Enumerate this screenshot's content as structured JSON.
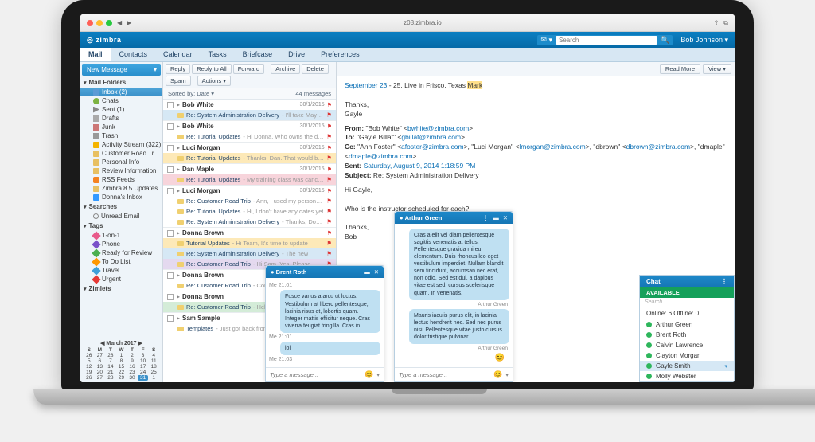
{
  "browser": {
    "url": "z08.zimbra.io"
  },
  "app": {
    "brand": "zimbra",
    "search_placeholder": "Search",
    "user": "Bob Johnson"
  },
  "tabs": [
    "Mail",
    "Contacts",
    "Calendar",
    "Tasks",
    "Briefcase",
    "Drive",
    "Preferences"
  ],
  "newmsg": "New Message",
  "sections": {
    "folders_hdr": "Mail Folders",
    "searches_hdr": "Searches",
    "tags_hdr": "Tags",
    "zimlets_hdr": "Zimlets"
  },
  "folders": [
    {
      "label": "Inbox (2)",
      "sel": true,
      "icon": "inbox"
    },
    {
      "label": "Chats",
      "icon": "chat"
    },
    {
      "label": "Sent (1)",
      "icon": "sent"
    },
    {
      "label": "Drafts",
      "icon": "draft"
    },
    {
      "label": "Junk",
      "icon": "junk"
    },
    {
      "label": "Trash",
      "icon": "trash"
    },
    {
      "label": "Activity Stream (322)",
      "icon": "act"
    },
    {
      "label": "Customer Road Tr",
      "icon": "folder"
    },
    {
      "label": "Personal Info",
      "icon": "folder"
    },
    {
      "label": "Review Information",
      "icon": "folder"
    },
    {
      "label": "RSS Feeds",
      "icon": "rss"
    },
    {
      "label": "Zimbra 8.5 Updates",
      "icon": "folder"
    },
    {
      "label": "Donna's Inbox",
      "icon": "share"
    }
  ],
  "searches": [
    {
      "label": "Unread Email"
    }
  ],
  "tags": [
    {
      "label": "1-on-1",
      "color": "#e85a8b"
    },
    {
      "label": "Phone",
      "color": "#7a52c9"
    },
    {
      "label": "Ready for Review",
      "color": "#4caf50"
    },
    {
      "label": "To Do List",
      "color": "#ff9800"
    },
    {
      "label": "Travel",
      "color": "#3f9fd8"
    },
    {
      "label": "Urgent",
      "color": "#e53935"
    }
  ],
  "calendar": {
    "title": "March 2017",
    "dow": [
      "S",
      "M",
      "T",
      "W",
      "T",
      "F",
      "S"
    ],
    "rows": [
      [
        "26",
        "27",
        "28",
        "1",
        "2",
        "3",
        "4"
      ],
      [
        "5",
        "6",
        "7",
        "8",
        "9",
        "10",
        "11"
      ],
      [
        "12",
        "13",
        "14",
        "15",
        "16",
        "17",
        "18"
      ],
      [
        "19",
        "20",
        "21",
        "22",
        "23",
        "24",
        "25"
      ],
      [
        "26",
        "27",
        "28",
        "29",
        "30",
        "31",
        "1"
      ]
    ],
    "today": "31"
  },
  "toolbar": [
    "Reply",
    "Reply to All",
    "Forward",
    "Archive",
    "Delete",
    "Spam",
    "Actions ▾"
  ],
  "sort": {
    "label": "Sorted by: Date ▾",
    "count": "44 messages"
  },
  "readbar": {
    "readmore": "Read More",
    "view": "View ▾"
  },
  "threads": [
    {
      "from": "Bob White",
      "date": "30/1/2015",
      "lines": [
        {
          "cls": "t-blue",
          "sub": "Re: System Administration Delivery",
          "prev": "- I'll take May and October. Bob F..."
        }
      ]
    },
    {
      "from": "Bob White",
      "date": "30/1/2015",
      "lines": [
        {
          "cls": "",
          "sub": "Re: Tutorial Updates",
          "prev": "- Hi Donna, Who owns the demo content updates? T"
        }
      ]
    },
    {
      "from": "Luci Morgan",
      "date": "30/1/2015",
      "lines": [
        {
          "cls": "t-yellow",
          "sub": "Re: Tutorial Updates",
          "prev": "- Thanks, Dan. That would be a huge help for m"
        }
      ]
    },
    {
      "from": "Dan Maple",
      "date": "30/1/2015",
      "lines": [
        {
          "cls": "t-pink",
          "sub": "Re: Tutorial Updates",
          "prev": "- My training class was cancelled next month, so"
        }
      ]
    },
    {
      "from": "Luci Morgan",
      "date": "30/1/2015",
      "lines": [
        {
          "cls": "",
          "sub": "Re: Customer Road Trip",
          "prev": "- Ann, I used my personal CC. L. From: \"afost"
        },
        {
          "cls": "",
          "sub": "Re: Tutorial Updates",
          "prev": "- Hi, I don't have any dates yet"
        },
        {
          "cls": "",
          "sub": "Re: System Administration Delivery",
          "prev": "- Thanks, Donna. I'm glad"
        }
      ]
    },
    {
      "from": "Donna Brown",
      "date": "",
      "lines": [
        {
          "cls": "t-yellow",
          "sub": "Tutorial Updates",
          "prev": "- Hi Team, It's time to update"
        },
        {
          "cls": "t-blue",
          "sub": "Re: System Administration Delivery",
          "prev": "- The new"
        },
        {
          "cls": "t-purple",
          "sub": "Re: Customer Road Trip",
          "prev": "- Hi Sam, Yes. Please"
        }
      ]
    },
    {
      "from": "Donna Brown",
      "date": "",
      "lines": [
        {
          "cls": "",
          "sub": "Re: Customer Road Trip",
          "prev": "- Corp travel? From: \"D"
        }
      ]
    },
    {
      "from": "Donna Brown",
      "date": "",
      "lines": [
        {
          "cls": "t-green",
          "sub": "Re: Customer Road Trip",
          "prev": "- Hello, Here are the as"
        }
      ]
    },
    {
      "from": "Sam Sample",
      "date": "",
      "lines": [
        {
          "cls": "",
          "sub": "Templates",
          "prev": "- Just got back from vacation. Mer"
        }
      ]
    }
  ],
  "reading": {
    "dateline_a": "September 23",
    "dateline_b": " - 25, Live in Frisco, Texas ",
    "dateline_hl": "Mark",
    "sig1a": "Thanks,",
    "sig1b": "Gayle",
    "from_lbl": "From:",
    "from_name": "\"Bob White\" ",
    "from_email": "bwhite@zimbra.com",
    "to_lbl": "To:",
    "to_name": "\"Gayle Billat\" ",
    "to_email": "gbillat@zimbra.com",
    "cc_lbl": "Cc:",
    "cc_1": "\"Ann Foster\" ",
    "cc_1e": "afoster@zimbra.com",
    "cc_2": ", \"Luci Morgan\" ",
    "cc_2e": "lmorgan@zimbra.com",
    "cc_3": ", \"dbrown\" ",
    "cc_3e": "dbrown@zimbra.com",
    "cc_4": ", \"dmaple\" ",
    "cc_4e": "dmaple@zimbra.com",
    "sent_lbl": "Sent:",
    "sent_val": "Saturday, August 9, 2014 1:18:59 PM",
    "subj_lbl": "Subject:",
    "subj_val": "Re: System Administration Delivery",
    "greet": "Hi Gayle,",
    "body": "Who is the instructor scheduled for each?",
    "sig2a": "Thanks,",
    "sig2b": "Bob"
  },
  "chats": [
    {
      "name": "Brent Roth",
      "msgs": [
        {
          "me": "Me  21:01",
          "text": "Fusce varius a arcu ut luctus. Vestibulum at libero pellentesque, lacinia risus et, lobortis quam. Integer mattis efficitur neque. Cras viverra feugiat fringilla. Cras in."
        },
        {
          "me": "Me  21:01",
          "text": "lol"
        },
        {
          "me": "Me  21:03",
          "text": ""
        }
      ],
      "placeholder": "Type a message..."
    },
    {
      "name": "Arthur Green",
      "msgs": [
        {
          "me": "",
          "text": "Cras a elit vel diam pellentesque sagittis venenatis at tellus. Pellentesque gravida mi eu elementum. Duis rhoncus leo eget vestibulum imperdiet. Nullam blandit sem tincidunt, accumsan nec erat, non odio. Sed est dui, a dapibus vitae est sed, cursus scelerisque quam. In venenatis.",
          "sig": "Arthur Green"
        },
        {
          "me": "",
          "text": "Mauris iaculis purus elit, in lacinia lectus hendrerit nec. Sed nec purus nisi. Pellentesque vitae justo cursus dolor tristique pulvinar.",
          "sig": "Arthur Green"
        }
      ],
      "placeholder": "Type a message..."
    }
  ],
  "buddy": {
    "title": "Chat",
    "avail": "AVAILABLE",
    "search": "Search",
    "status": "Online: 6 Offline: 0",
    "list": [
      {
        "name": "Arthur Green"
      },
      {
        "name": "Brent Roth"
      },
      {
        "name": "Calvin Lawrence"
      },
      {
        "name": "Clayton Morgan"
      },
      {
        "name": "Gayle Smith",
        "sel": true
      },
      {
        "name": "Molly Webster"
      }
    ]
  }
}
